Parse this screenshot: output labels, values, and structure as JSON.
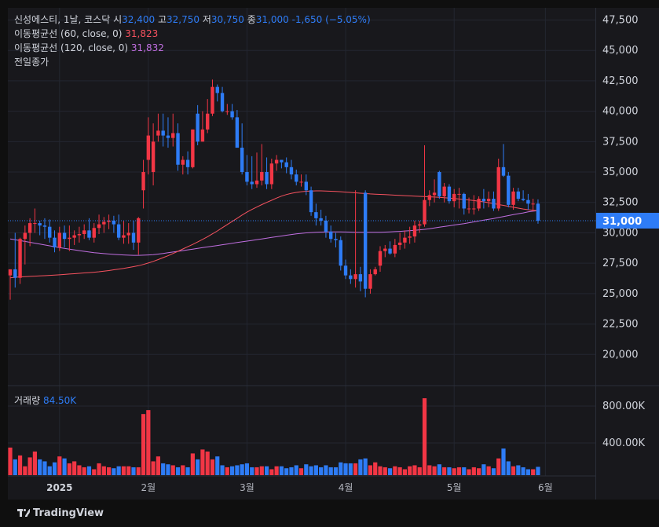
{
  "legend": {
    "symbol": "신성에스티, 1날, 코스닥",
    "open_label": "시",
    "open": "32,400",
    "high_label": "고",
    "high": "32,750",
    "low_label": "저",
    "low": "30,750",
    "close_label": "종",
    "close": "31,000",
    "change": "-1,650 (−5.05%)",
    "ma60_label": "이동평균선 (60, close, 0)",
    "ma60_value": "31,823",
    "ma120_label": "이동평균선 (120, close, 0)",
    "ma120_value": "31,832",
    "prev_close_label": "전일종가"
  },
  "volume": {
    "label": "거래량",
    "value": "84.50K",
    "axis_ticks": [
      "800.00K",
      "400.00K"
    ]
  },
  "price_axis": {
    "ticks": [
      "47,500",
      "45,000",
      "42,500",
      "40,000",
      "37,500",
      "35,000",
      "32,500",
      "30,000",
      "27,500",
      "25,000",
      "22,500",
      "20,000"
    ],
    "current_price_label": "31,000"
  },
  "time_axis": {
    "labels": [
      "2025",
      "2월",
      "3월",
      "4월",
      "5월",
      "6월"
    ]
  },
  "branding": {
    "logo_text": "TradingView"
  },
  "chart_data": {
    "type": "candlestick",
    "ylim": [
      17500,
      48500
    ],
    "volume_ylim": [
      0,
      900000
    ],
    "current_price": 31000,
    "colors": {
      "up": "#f23645",
      "down": "#2e7cf6",
      "ma60": "#f7525f",
      "ma120": "#c06ee0"
    },
    "x": [
      "2024-12-16",
      "2024-12-17",
      "2024-12-18",
      "2024-12-19",
      "2024-12-20",
      "2024-12-23",
      "2024-12-24",
      "2024-12-26",
      "2024-12-27",
      "2024-12-30",
      "2025-01-02",
      "2025-01-03",
      "2025-01-06",
      "2025-01-07",
      "2025-01-08",
      "2025-01-09",
      "2025-01-10",
      "2025-01-13",
      "2025-01-14",
      "2025-01-15",
      "2025-01-16",
      "2025-01-17",
      "2025-01-20",
      "2025-01-21",
      "2025-01-22",
      "2025-01-23",
      "2025-01-24",
      "2025-01-31",
      "2025-02-03",
      "2025-02-04",
      "2025-02-05",
      "2025-02-06",
      "2025-02-07",
      "2025-02-10",
      "2025-02-11",
      "2025-02-12",
      "2025-02-13",
      "2025-02-14",
      "2025-02-17",
      "2025-02-18",
      "2025-02-19",
      "2025-02-20",
      "2025-02-21",
      "2025-02-24",
      "2025-02-25",
      "2025-02-26",
      "2025-02-27",
      "2025-02-28",
      "2025-03-04",
      "2025-03-05",
      "2025-03-06",
      "2025-03-07",
      "2025-03-10",
      "2025-03-11",
      "2025-03-12",
      "2025-03-13",
      "2025-03-14",
      "2025-03-17",
      "2025-03-18",
      "2025-03-19",
      "2025-03-20",
      "2025-03-21",
      "2025-03-24",
      "2025-03-25",
      "2025-03-26",
      "2025-03-27",
      "2025-03-28",
      "2025-03-31",
      "2025-04-01",
      "2025-04-02",
      "2025-04-03",
      "2025-04-04",
      "2025-04-07",
      "2025-04-08",
      "2025-04-09",
      "2025-04-10",
      "2025-04-11",
      "2025-04-14",
      "2025-04-15",
      "2025-04-16",
      "2025-04-17",
      "2025-04-18",
      "2025-04-21",
      "2025-04-22",
      "2025-04-23",
      "2025-04-24",
      "2025-04-25",
      "2025-04-28",
      "2025-04-29",
      "2025-04-30",
      "2025-05-02",
      "2025-05-07",
      "2025-05-08",
      "2025-05-09",
      "2025-05-12",
      "2025-05-13",
      "2025-05-14",
      "2025-05-15",
      "2025-05-16",
      "2025-05-19",
      "2025-05-20",
      "2025-05-21",
      "2025-05-22",
      "2025-05-23",
      "2025-05-26",
      "2025-05-27",
      "2025-05-28",
      "2025-05-29"
    ],
    "open": [
      26500,
      27000,
      26300,
      29500,
      30000,
      30800,
      30800,
      30600,
      30500,
      29600,
      28800,
      30000,
      29500,
      29600,
      29800,
      29900,
      30200,
      29600,
      30400,
      30700,
      30900,
      31000,
      30700,
      29600,
      29800,
      30000,
      29200,
      33500,
      36000,
      35000,
      38000,
      38400,
      38000,
      37800,
      38200,
      35600,
      36000,
      35400,
      39800,
      37500,
      38500,
      39800,
      42000,
      41500,
      40000,
      40000,
      39500,
      37000,
      35000,
      34200,
      34000,
      34300,
      35000,
      34000,
      35700,
      36000,
      35800,
      35400,
      34800,
      34200,
      34200,
      33500,
      31700,
      31200,
      31000,
      30100,
      29500,
      29400,
      27300,
      26500,
      26200,
      26600,
      33300,
      25400,
      26600,
      27300,
      28500,
      28700,
      28300,
      29000,
      29200,
      29600,
      29700,
      30600,
      30700,
      32700,
      33100,
      35000,
      33000,
      33800,
      32600,
      33200,
      33200,
      32000,
      32000,
      32000,
      32800,
      32600,
      32800,
      32000,
      35400,
      34700,
      32300,
      33400,
      32800,
      32700,
      32400,
      32400
    ],
    "high": [
      27000,
      30000,
      29600,
      30600,
      31200,
      32000,
      31000,
      31200,
      31100,
      30200,
      30500,
      30600,
      30600,
      30200,
      30500,
      30700,
      31200,
      30800,
      31500,
      31300,
      31500,
      31400,
      31500,
      31000,
      30800,
      31000,
      31300,
      36000,
      39500,
      39000,
      39800,
      39800,
      39500,
      39800,
      39000,
      36300,
      36700,
      38500,
      40500,
      40000,
      41000,
      42600,
      42200,
      42000,
      40600,
      40600,
      40100,
      39000,
      36400,
      36300,
      36600,
      37300,
      36200,
      36100,
      36400,
      36000,
      36200,
      36000,
      35200,
      34800,
      34800,
      33800,
      32400,
      31900,
      31400,
      30600,
      30000,
      29700,
      27800,
      27000,
      33500,
      27200,
      33500,
      27000,
      27200,
      28900,
      29000,
      29300,
      29500,
      30000,
      30200,
      30500,
      31000,
      31000,
      37200,
      33500,
      34400,
      35100,
      34100,
      34000,
      33600,
      33700,
      33300,
      32900,
      33100,
      33000,
      33600,
      33400,
      33400,
      36100,
      37300,
      35000,
      33700,
      33700,
      33500,
      33200,
      32800,
      32750
    ],
    "low": [
      24500,
      25500,
      25800,
      27400,
      28900,
      30000,
      29800,
      29500,
      29200,
      28400,
      28500,
      28800,
      28500,
      29000,
      29200,
      29500,
      29400,
      29200,
      29900,
      30000,
      30300,
      30000,
      29400,
      29100,
      29100,
      28600,
      28200,
      32000,
      34800,
      33900,
      37500,
      37100,
      37000,
      37100,
      35100,
      34800,
      34800,
      35300,
      37200,
      37500,
      38200,
      39600,
      40800,
      39900,
      39700,
      39300,
      37000,
      34800,
      33900,
      33600,
      33700,
      33900,
      33600,
      33600,
      35100,
      35300,
      34900,
      34400,
      33900,
      33800,
      33100,
      31400,
      30600,
      30600,
      29600,
      29200,
      28800,
      26900,
      26200,
      25800,
      25500,
      25200,
      24700,
      25000,
      26500,
      26800,
      28000,
      28200,
      28000,
      28600,
      28700,
      29100,
      29200,
      30000,
      30500,
      32200,
      32500,
      32800,
      32500,
      32400,
      32100,
      32000,
      31500,
      31600,
      31500,
      31800,
      32000,
      32100,
      31800,
      31800,
      34600,
      32100,
      31900,
      32600,
      32600,
      31900,
      31800,
      30750
    ],
    "close": [
      27000,
      26300,
      29500,
      30000,
      30800,
      30800,
      30600,
      30500,
      29600,
      28800,
      30000,
      29500,
      29600,
      29800,
      29900,
      30200,
      29600,
      30400,
      30700,
      30900,
      31000,
      30700,
      29600,
      29800,
      30000,
      29200,
      31200,
      35000,
      38000,
      37500,
      38400,
      38000,
      37800,
      38200,
      35600,
      36000,
      35400,
      38500,
      37500,
      38500,
      39800,
      42000,
      41500,
      40000,
      40000,
      39500,
      37000,
      35000,
      34200,
      34000,
      34300,
      35000,
      34000,
      35700,
      36000,
      35800,
      35400,
      34800,
      34200,
      34200,
      33500,
      31700,
      31200,
      31000,
      30100,
      29500,
      29400,
      27300,
      26500,
      26200,
      26600,
      26000,
      25400,
      26600,
      27000,
      28500,
      28700,
      28300,
      29000,
      29200,
      29600,
      29700,
      30600,
      30700,
      32700,
      33100,
      33300,
      33000,
      33800,
      32600,
      33200,
      33200,
      32000,
      32000,
      32000,
      32800,
      32600,
      32800,
      32000,
      35400,
      34700,
      32300,
      33400,
      32800,
      32700,
      32400,
      32400,
      31000
    ],
    "volume": [
      280000,
      160000,
      200000,
      90000,
      180000,
      240000,
      160000,
      140000,
      90000,
      130000,
      190000,
      170000,
      120000,
      140000,
      100000,
      80000,
      90000,
      60000,
      120000,
      90000,
      80000,
      70000,
      90000,
      90000,
      90000,
      80000,
      80000,
      620000,
      660000,
      140000,
      190000,
      120000,
      110000,
      100000,
      80000,
      100000,
      80000,
      220000,
      160000,
      260000,
      240000,
      160000,
      190000,
      100000,
      80000,
      90000,
      100000,
      110000,
      120000,
      80000,
      80000,
      90000,
      90000,
      60000,
      90000,
      90000,
      70000,
      80000,
      100000,
      70000,
      110000,
      90000,
      100000,
      80000,
      100000,
      80000,
      80000,
      130000,
      120000,
      120000,
      120000,
      160000,
      170000,
      100000,
      130000,
      90000,
      80000,
      70000,
      90000,
      80000,
      60000,
      90000,
      100000,
      80000,
      780000,
      100000,
      90000,
      110000,
      80000,
      80000,
      70000,
      80000,
      80000,
      60000,
      80000,
      70000,
      110000,
      90000,
      70000,
      170000,
      270000,
      140000,
      90000,
      100000,
      80000,
      60000,
      60000,
      84500
    ],
    "ma60": [
      26300,
      26350,
      26380,
      26400,
      26420,
      26440,
      26460,
      26480,
      26500,
      26520,
      26550,
      26580,
      26610,
      26640,
      26670,
      26700,
      26730,
      26760,
      26800,
      26850,
      26900,
      26960,
      27020,
      27080,
      27150,
      27220,
      27300,
      27400,
      27520,
      27650,
      27800,
      27960,
      28120,
      28300,
      28480,
      28670,
      28860,
      29050,
      29250,
      29460,
      29680,
      29920,
      30160,
      30420,
      30680,
      30940,
      31200,
      31460,
      31700,
      31920,
      32120,
      32320,
      32500,
      32680,
      32860,
      33020,
      33150,
      33250,
      33320,
      33380,
      33420,
      33440,
      33450,
      33450,
      33440,
      33420,
      33400,
      33380,
      33350,
      33320,
      33290,
      33260,
      33230,
      33200,
      33180,
      33160,
      33140,
      33120,
      33100,
      33080,
      33060,
      33040,
      33020,
      33000,
      32980,
      32960,
      32940,
      32920,
      32890,
      32860,
      32820,
      32780,
      32740,
      32700,
      32650,
      32600,
      32550,
      32480,
      32400,
      32330,
      32260,
      32180,
      32100,
      32030,
      31960,
      31900,
      31860,
      31823
    ],
    "ma120": [
      29500,
      29430,
      29360,
      29290,
      29220,
      29150,
      29080,
      29000,
      28930,
      28860,
      28790,
      28720,
      28660,
      28600,
      28540,
      28480,
      28420,
      28370,
      28330,
      28290,
      28260,
      28230,
      28200,
      28180,
      28160,
      28150,
      28150,
      28160,
      28180,
      28210,
      28250,
      28300,
      28360,
      28420,
      28480,
      28540,
      28600,
      28660,
      28720,
      28780,
      28840,
      28900,
      28960,
      29020,
      29080,
      29140,
      29200,
      29260,
      29320,
      29380,
      29440,
      29500,
      29560,
      29620,
      29680,
      29740,
      29800,
      29860,
      29920,
      29960,
      30000,
      30020,
      30040,
      30060,
      30070,
      30080,
      30080,
      30080,
      30070,
      30060,
      30050,
      30040,
      30040,
      30040,
      30040,
      30050,
      30060,
      30080,
      30100,
      30120,
      30150,
      30180,
      30210,
      30250,
      30290,
      30340,
      30400,
      30460,
      30520,
      30580,
      30640,
      30700,
      30760,
      30830,
      30900,
      30970,
      31040,
      31110,
      31180,
      31260,
      31340,
      31420,
      31500,
      31570,
      31640,
      31720,
      31780,
      31832
    ]
  }
}
